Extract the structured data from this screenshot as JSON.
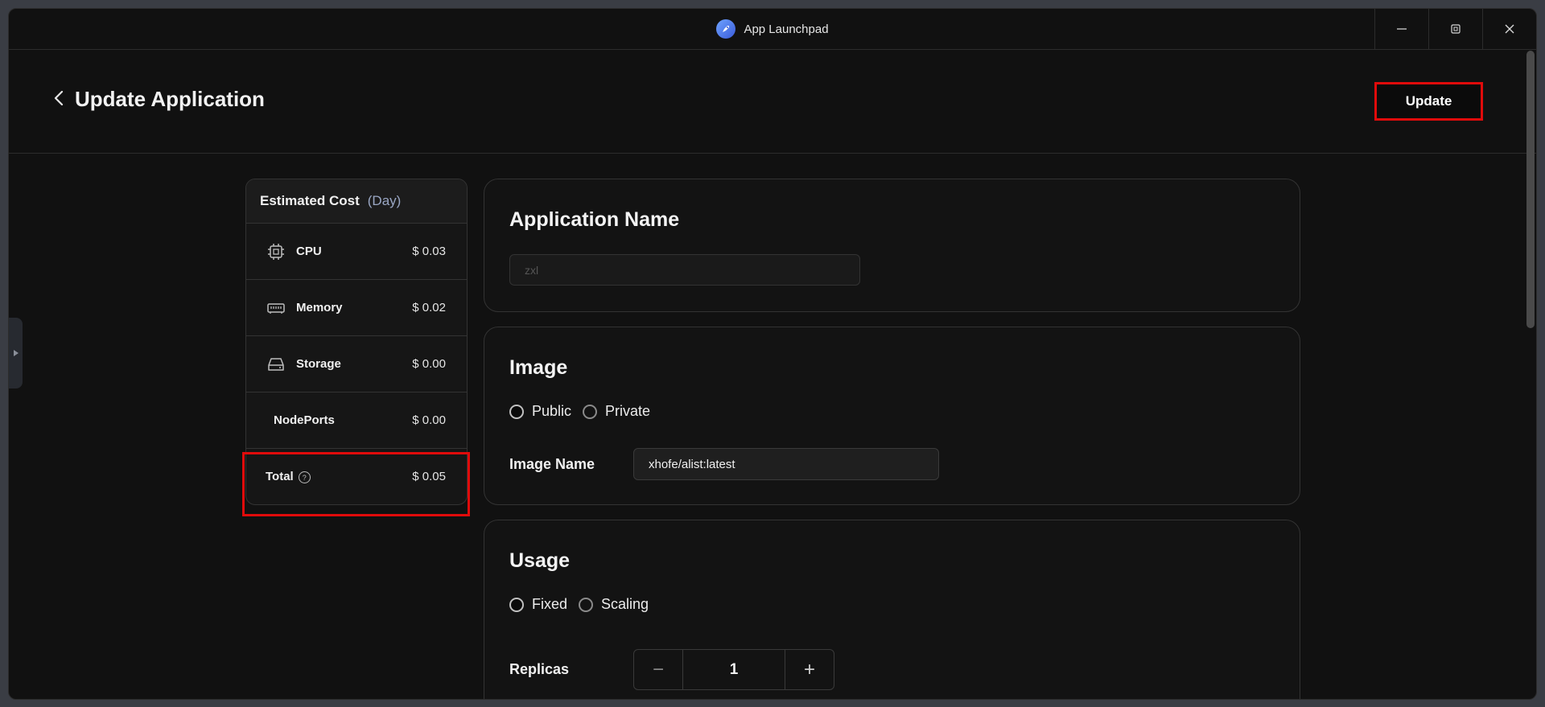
{
  "window": {
    "title": "App Launchpad"
  },
  "header": {
    "title": "Update Application",
    "update_label": "Update"
  },
  "cost": {
    "title": "Estimated Cost",
    "period": "(Day)",
    "rows": [
      {
        "icon": "cpu-icon",
        "label": "CPU",
        "value": "$ 0.03"
      },
      {
        "icon": "memory-icon",
        "label": "Memory",
        "value": "$ 0.02"
      },
      {
        "icon": "storage-icon",
        "label": "Storage",
        "value": "$ 0.00"
      },
      {
        "icon": "",
        "label": "NodePorts",
        "value": "$ 0.00"
      }
    ],
    "total": {
      "label": "Total",
      "value": "$ 0.05"
    }
  },
  "app_name": {
    "title": "Application Name",
    "value": "zxl"
  },
  "image": {
    "title": "Image",
    "options": [
      "Public",
      "Private"
    ],
    "name_label": "Image Name",
    "name_value": "xhofe/alist:latest"
  },
  "usage": {
    "title": "Usage",
    "options": [
      "Fixed",
      "Scaling"
    ],
    "replicas_label": "Replicas",
    "replicas_value": "1",
    "minus": "−",
    "plus": "+"
  },
  "colors": {
    "highlight": "#e00b0b",
    "background": "#111111"
  }
}
